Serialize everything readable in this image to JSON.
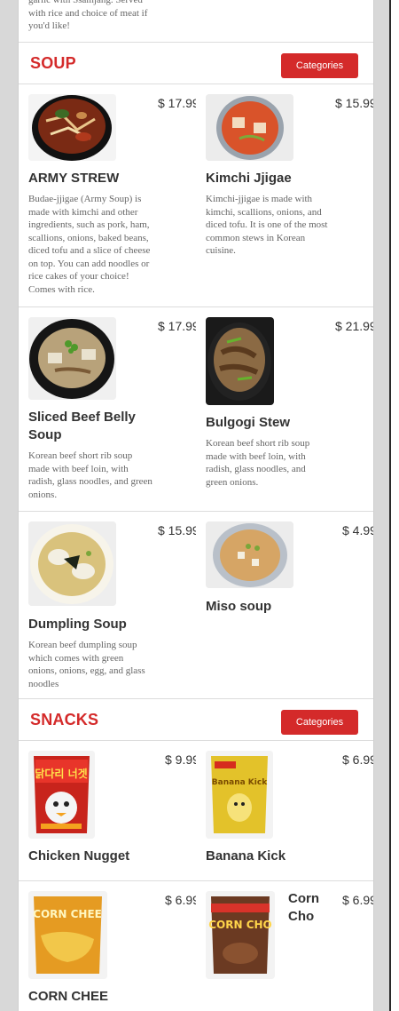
{
  "prev_item": {
    "desc": "garlic with Ssamjang. Served with rice and choice of meat if you'd like!"
  },
  "soup": {
    "title": "SOUP",
    "button": "Categories",
    "items": [
      {
        "name": "ARMY STREW",
        "price": "$ 17.99",
        "desc": "Budae-jjigae (Army Soup) is made with kimchi and other ingredients, such as pork, ham, scallions, onions, baked beans, diced tofu and a slice of cheese on top. You can add noodles or rice cakes of your choice! Comes with rice."
      },
      {
        "name": "Kimchi Jjigae",
        "price": "$ 15.99",
        "desc": "Kimchi-jjigae is made with kimchi, scallions, onions, and diced tofu. It is one of the most common stews in Korean cuisine."
      },
      {
        "name": "Sliced Beef Belly Soup",
        "price": "$ 17.99",
        "desc": "Korean beef short rib soup made with beef loin, with radish, glass noodles, and green onions."
      },
      {
        "name": "Bulgogi Stew",
        "price": "$ 21.99",
        "desc": "Korean beef short rib soup made with beef loin, with radish, glass noodles, and green onions."
      },
      {
        "name": "Dumpling Soup",
        "price": "$ 15.99",
        "desc": "Korean beef dumpling soup which comes with green onions, onions, egg, and glass noodles"
      },
      {
        "name": "Miso soup",
        "price": "$ 4.99",
        "desc": ""
      }
    ]
  },
  "snacks": {
    "title": "SNACKS",
    "button": "Categories",
    "items": [
      {
        "name": "Chicken Nugget",
        "price": "$ 9.99",
        "package_text": "닭다리 너겟"
      },
      {
        "name": "Banana Kick",
        "price": "$ 6.99",
        "package_text": "Banana Kick"
      },
      {
        "name": "CORN CHEE",
        "price": "$ 6.99",
        "package_text": "CORN CHEE"
      },
      {
        "name": "Corn Cho",
        "price": "$ 6.99",
        "package_text": "CORN CHO"
      }
    ]
  },
  "colors": {
    "accent": "#d42a2a",
    "text": "#333333",
    "muted": "#666666"
  }
}
